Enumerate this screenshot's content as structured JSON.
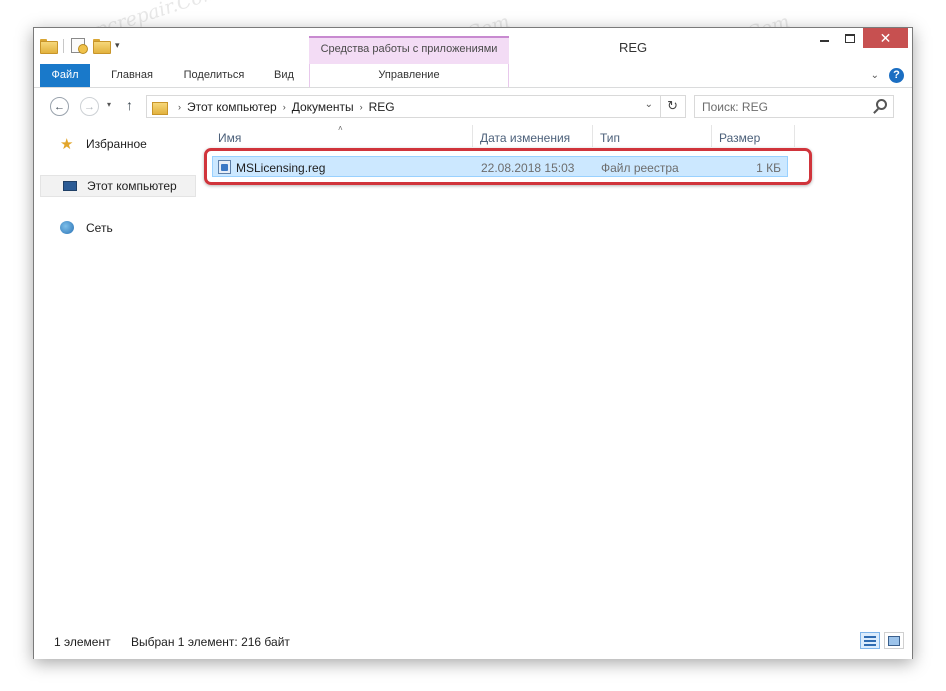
{
  "titlebar": {
    "context_group": "Средства работы с приложениями",
    "window_title": "REG",
    "close_symbol": "✕",
    "dropdown_symbol": "▾"
  },
  "ribbon": {
    "tabs": {
      "file": "Файл",
      "home": "Главная",
      "share": "Поделиться",
      "view": "Вид",
      "manage": "Управление"
    },
    "help_symbol": "?",
    "expand_symbol": "⌄"
  },
  "navigation": {
    "back_symbol": "←",
    "forward_symbol": "→",
    "recent_symbol": "▾",
    "up_symbol": "↑"
  },
  "address": {
    "crumbs": [
      "Этот компьютер",
      "Документы",
      "REG"
    ],
    "separator": "›",
    "dropdown_symbol": "⌄",
    "refresh_symbol": "↻"
  },
  "search": {
    "placeholder": "Поиск: REG"
  },
  "sidebar": {
    "items": [
      {
        "label": "Избранное",
        "icon": "star-icon"
      },
      {
        "label": "Этот компьютер",
        "icon": "computer-icon",
        "selected": true
      },
      {
        "label": "Сеть",
        "icon": "network-icon"
      }
    ]
  },
  "columns": {
    "name": "Имя",
    "date": "Дата изменения",
    "type": "Тип",
    "size": "Размер",
    "sort_symbol": "˄"
  },
  "files": [
    {
      "name": "MSLicensing.reg",
      "date": "22.08.2018 15:03",
      "type": "Файл реестра",
      "size": "1 КБ",
      "selected": true
    }
  ],
  "status": {
    "count": "1 элемент",
    "selection": "Выбран 1 элемент: 216 байт"
  },
  "watermark": {
    "text": "Soringpcrepair.Com"
  },
  "colors": {
    "file_tab": "#1979ca",
    "context_tab": "#f3dcf5",
    "selection": "#cce8ff",
    "highlight_ring": "#d0343b",
    "close_button": "#c75050"
  }
}
